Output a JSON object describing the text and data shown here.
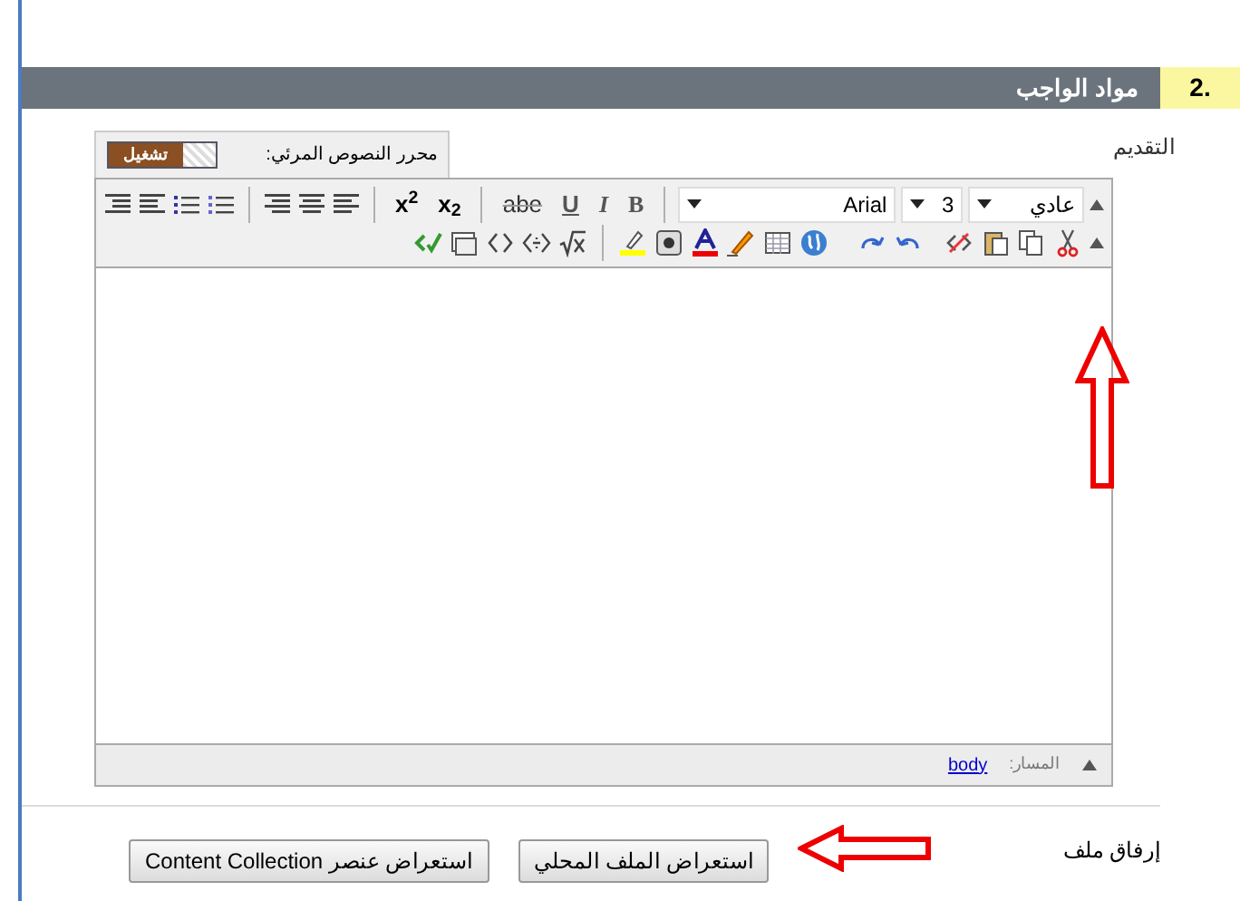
{
  "section": {
    "number": "2.",
    "title": "مواد الواجب"
  },
  "intro_label": "التقديم",
  "editor": {
    "mode_label": "محرر النصوص المرئي:",
    "toggle": {
      "label": "تشغيل",
      "on": true
    },
    "format_select": "عادي",
    "size_select": "3",
    "font_select": "Arial",
    "text_buttons": [
      {
        "kind": "bold",
        "label": "B"
      },
      {
        "kind": "italic",
        "label": "I"
      },
      {
        "kind": "underline",
        "label": "U"
      },
      {
        "kind": "strike",
        "label": "abe"
      },
      {
        "kind": "sub",
        "label": "x$_{2}$"
      },
      {
        "kind": "sup",
        "label": "x$^{2}$"
      }
    ],
    "path_label": "المسار:",
    "path_link": "body"
  },
  "attach": {
    "label": "إرفاق ملف",
    "buttons": [
      "استعراض الملف المحلي",
      "استعراض عنصر Content Collection"
    ]
  }
}
